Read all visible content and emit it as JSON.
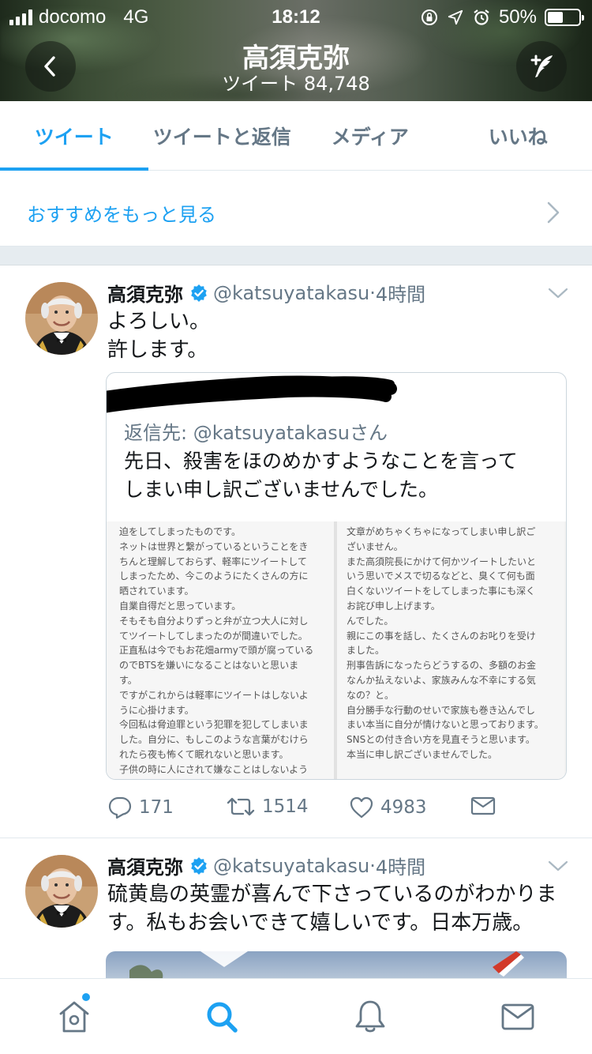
{
  "status_bar": {
    "carrier": "docomo",
    "network": "4G",
    "time": "18:12",
    "battery_percent": "50%",
    "battery_level": 0.5,
    "icons": [
      "orientation-lock-icon",
      "location-arrow-icon",
      "alarm-icon"
    ]
  },
  "header": {
    "title": "高須克弥",
    "tweet_count": "ツイート 84,748",
    "back_icon": "chevron-left-icon",
    "compose_icon": "compose-tweet-icon"
  },
  "tabs": [
    {
      "label": "ツイート",
      "active": true
    },
    {
      "label": "ツイートと返信",
      "active": false
    },
    {
      "label": "メディア",
      "active": false
    },
    {
      "label": "いいね",
      "active": false
    }
  ],
  "recommend": {
    "label": "おすすめをもっと見る"
  },
  "tweets": [
    {
      "name": "高須克弥",
      "handle": "@katsuyatakasu",
      "dot": "·",
      "time": "4時間",
      "text_lines": [
        "よろしい。",
        "許します。"
      ],
      "quote": {
        "reply_to": "返信先: @katsuyatakasuさん",
        "text_lines": [
          "先日、殺害をほのめかすようなことを言って",
          "しまい申し訳ございませんでした。"
        ],
        "media_left_lines": [
          "迫をしてしまったものです。",
          "ネットは世界と繋がっているということをき",
          "ちんと理解しておらず、軽率にツイートして",
          "しまったため、今このようにたくさんの方に",
          "晒されています。",
          "自業自得だと思っています。",
          "そもそも自分よりずっと弁が立つ大人に対し",
          "てツイートしてしまったのが間違いでした。",
          "正直私は今でもお花畑armyで頭が腐っている",
          "のでBTSを嫌いになることはないと思いま",
          "す。",
          "ですがこれからは軽率にツイートはしないよ",
          "うに心掛けます。",
          "今回私は脅迫罪という犯罪を犯してしまいま",
          "した。自分に、もしこのような言葉がむけら",
          "れたら夜も怖くて眠れないと思います。",
          "子供の時に人にされて嫌なことはしないよう"
        ],
        "media_right_lines": [
          "文章がめちゃくちゃになってしまい申し訳ご",
          "ざいません。",
          "また高須院長にかけて何かツイートしたいと",
          "いう思いでメスで切るなどと、臭くて何も面",
          "白くないツイートをしてしまった事にも深く",
          "お詫び申し上げます。",
          "んでした。",
          "親にこの事を話し、たくさんのお叱りを受け",
          "ました。",
          "刑事告訴になったらどうするの、多額のお金",
          "なんか払えないよ、家族みんな不幸にする気",
          "なの？と。",
          "自分勝手な行動のせいで家族も巻き込んでし",
          "まい本当に自分が情けないと思っております。",
          "SNSとの付き合い方を見直そうと思います。",
          "本当に申し訳ございませんでした。"
        ]
      },
      "actions": {
        "replies": "171",
        "retweets": "1514",
        "likes": "4983"
      }
    },
    {
      "name": "高須克弥",
      "handle": "@katsuyatakasu",
      "dot": "·",
      "time": "4時間",
      "text_lines": [
        "硫黄島の英霊が喜んで下さっているのがわかりま",
        "す。私もお会いできて嬉しいです。日本万歳。"
      ]
    }
  ],
  "bottom_nav": [
    {
      "icon": "home-icon",
      "active": false,
      "has_notification": true
    },
    {
      "icon": "search-icon",
      "active": true
    },
    {
      "icon": "bell-icon",
      "active": false
    },
    {
      "icon": "mail-icon",
      "active": false
    }
  ],
  "colors": {
    "accent": "#1da1f2",
    "secondary_text": "#657786",
    "primary_text": "#14171a",
    "divider": "#e1e8ed"
  }
}
